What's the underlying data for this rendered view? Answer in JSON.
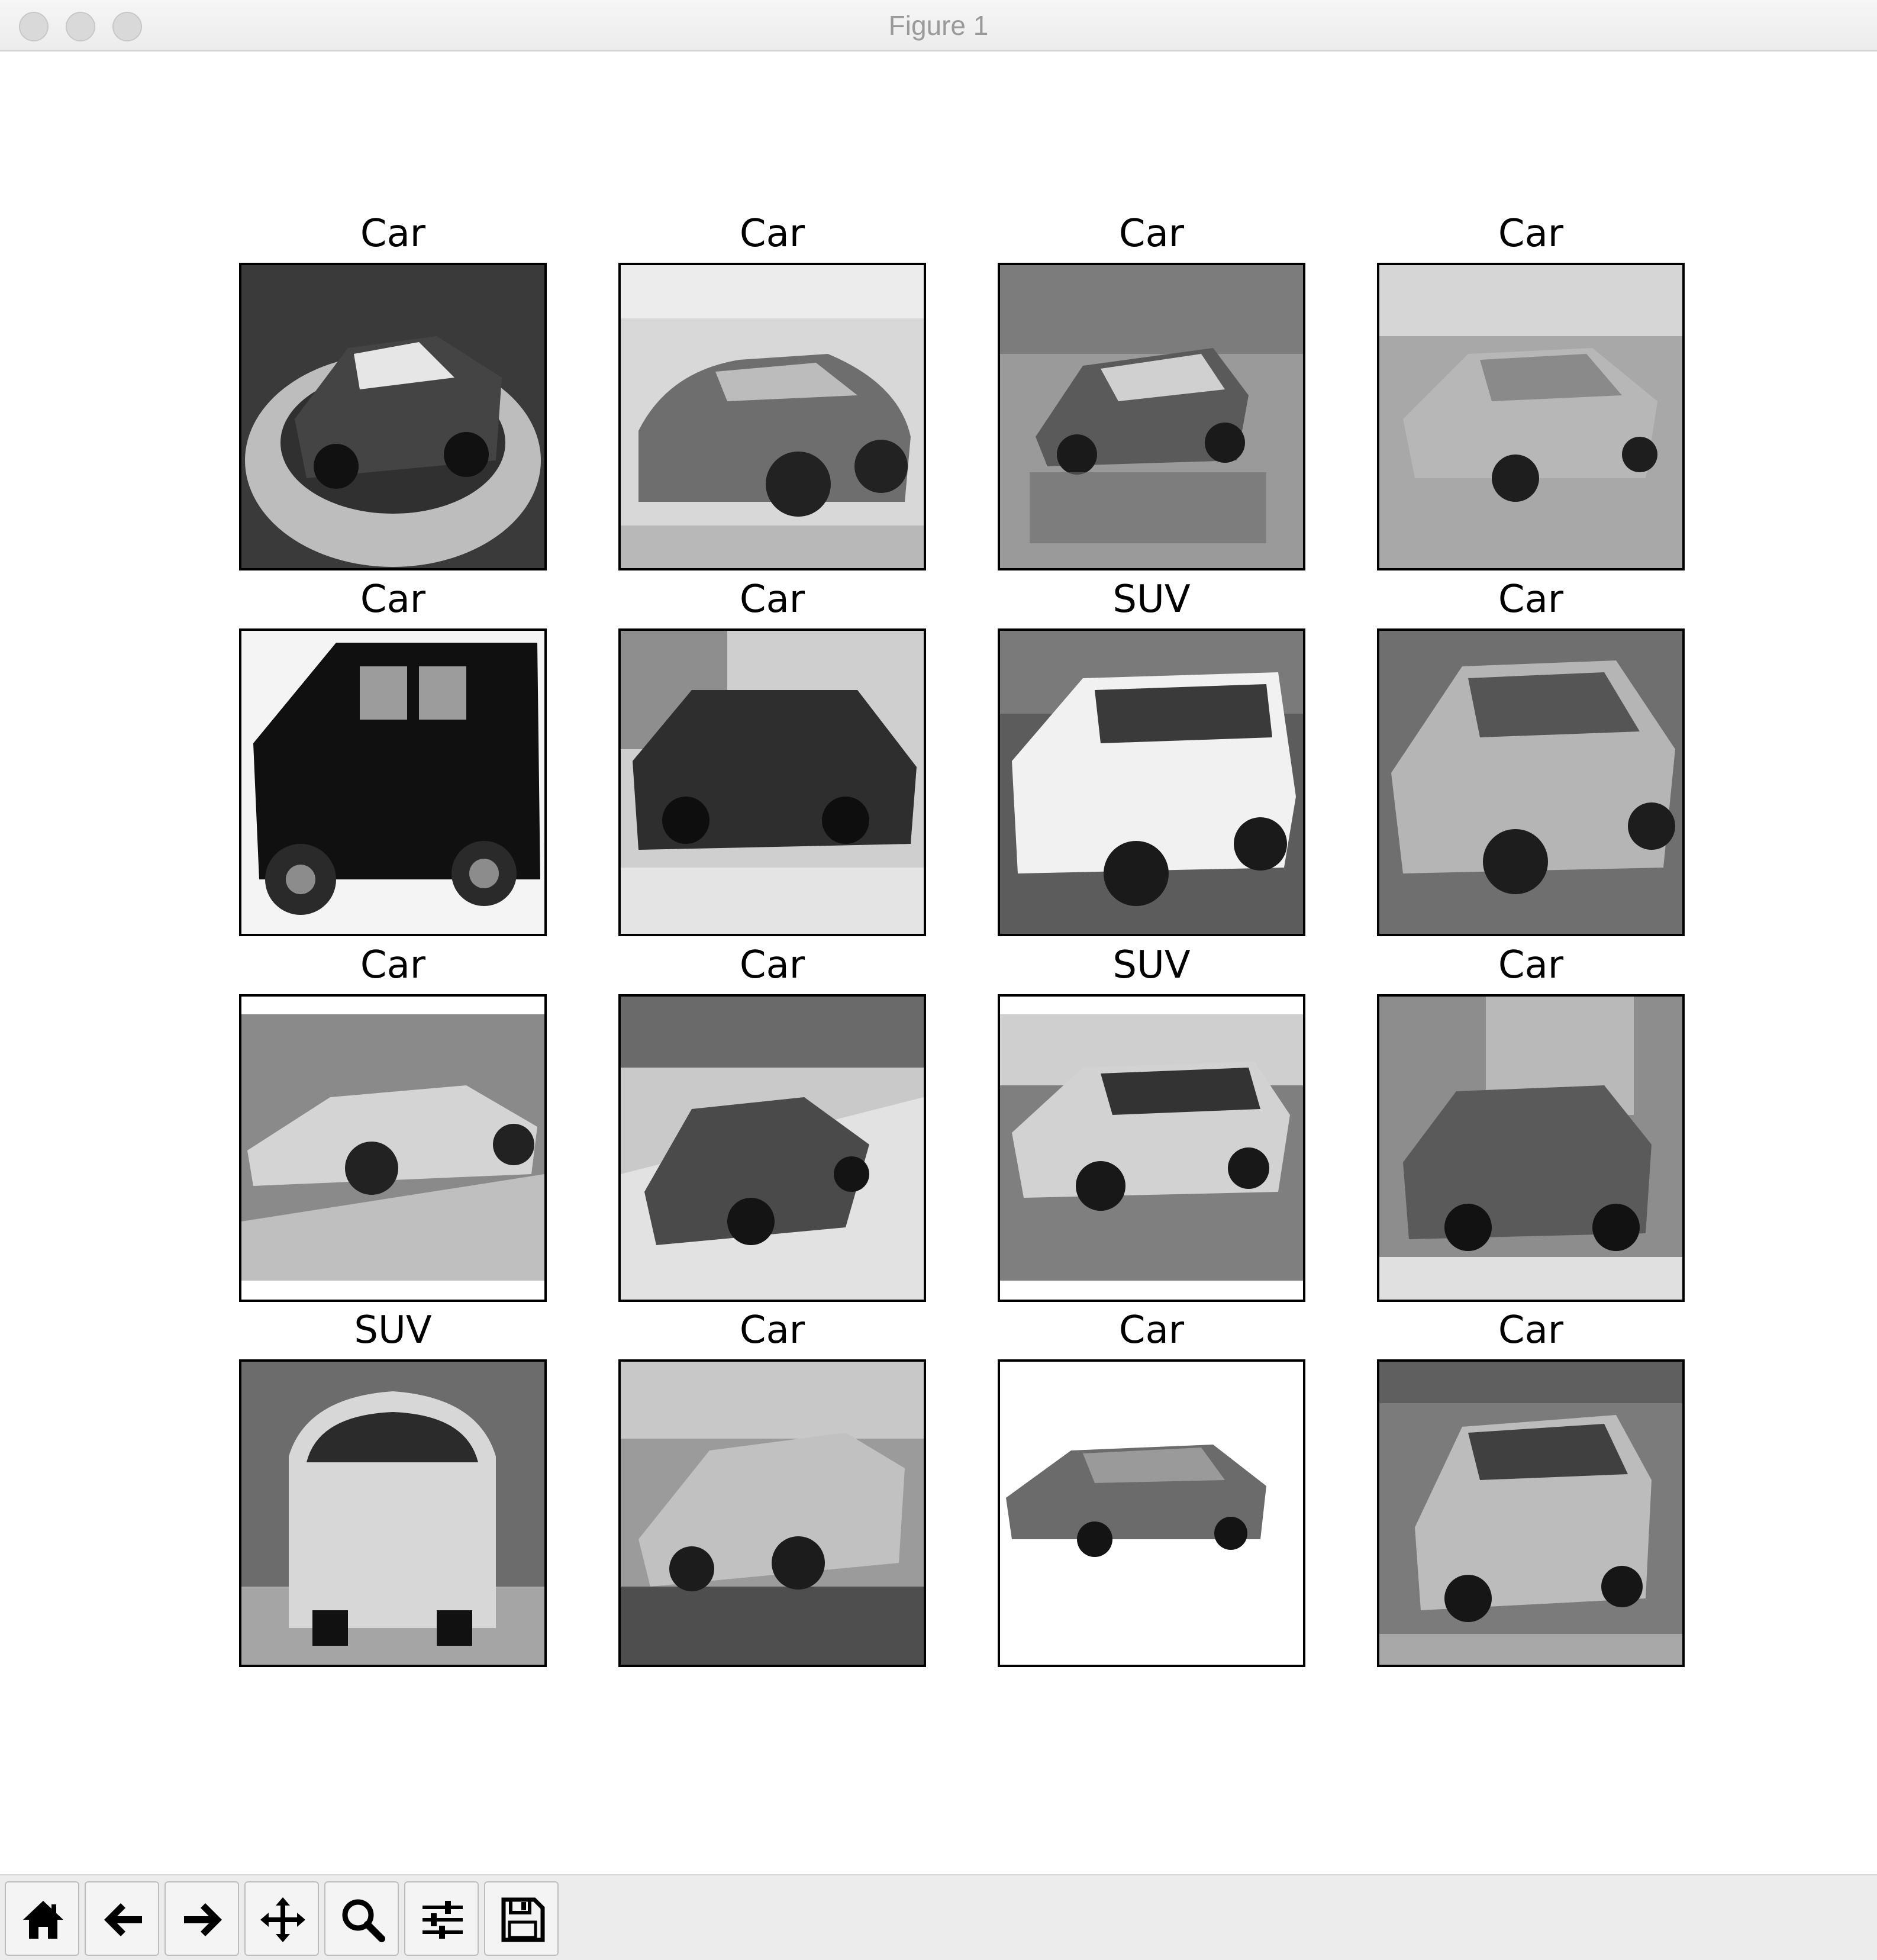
{
  "window": {
    "title": "Figure 1"
  },
  "subplots": [
    {
      "label": "Car"
    },
    {
      "label": "Car"
    },
    {
      "label": "Car"
    },
    {
      "label": "Car"
    },
    {
      "label": "Car"
    },
    {
      "label": "Car"
    },
    {
      "label": "SUV"
    },
    {
      "label": "Car"
    },
    {
      "label": "Car"
    },
    {
      "label": "Car"
    },
    {
      "label": "SUV"
    },
    {
      "label": "Car"
    },
    {
      "label": "SUV"
    },
    {
      "label": "Car"
    },
    {
      "label": "Car"
    },
    {
      "label": "Car"
    }
  ],
  "toolbar": {
    "buttons": [
      {
        "icon": "home-icon"
      },
      {
        "icon": "back-arrow-icon"
      },
      {
        "icon": "forward-arrow-icon"
      },
      {
        "icon": "pan-move-icon"
      },
      {
        "icon": "zoom-magnifier-icon"
      },
      {
        "icon": "configure-subplots-icon"
      },
      {
        "icon": "save-floppy-icon"
      }
    ]
  }
}
